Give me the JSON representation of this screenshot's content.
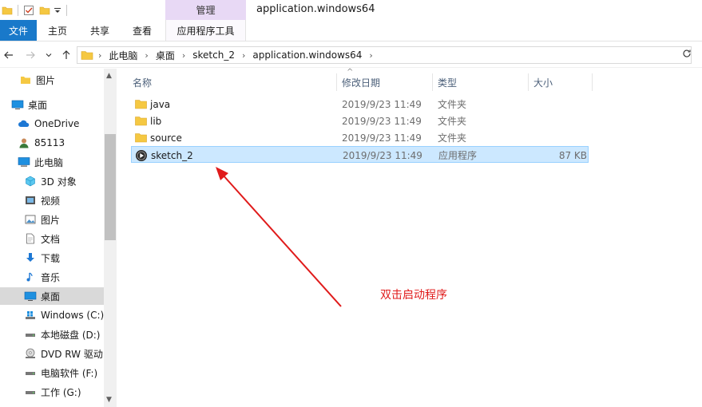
{
  "window": {
    "title": "application.windows64",
    "manage_tab": "管理"
  },
  "ribbon": {
    "tabs": [
      {
        "label": "文件"
      },
      {
        "label": "主页"
      },
      {
        "label": "共享"
      },
      {
        "label": "查看"
      },
      {
        "label": "应用程序工具"
      }
    ]
  },
  "address": {
    "breadcrumbs": [
      "此电脑",
      "桌面",
      "sketch_2",
      "application.windows64"
    ]
  },
  "nav": {
    "items": [
      {
        "label": "图片",
        "icon": "folder-icon"
      },
      {
        "label": "桌面",
        "icon": "desktop-icon"
      },
      {
        "label": "OneDrive",
        "icon": "cloud-icon"
      },
      {
        "label": "85113",
        "icon": "user-icon"
      },
      {
        "label": "此电脑",
        "icon": "computer-icon"
      },
      {
        "label": "3D 对象",
        "icon": "cube-icon"
      },
      {
        "label": "视频",
        "icon": "video-icon"
      },
      {
        "label": "图片",
        "icon": "pictures-icon"
      },
      {
        "label": "文档",
        "icon": "document-icon"
      },
      {
        "label": "下载",
        "icon": "download-icon"
      },
      {
        "label": "音乐",
        "icon": "music-icon"
      },
      {
        "label": "桌面",
        "icon": "desktop-icon"
      },
      {
        "label": "Windows (C:)",
        "icon": "windows-drive-icon"
      },
      {
        "label": "本地磁盘 (D:)",
        "icon": "drive-icon"
      },
      {
        "label": "DVD RW 驱动",
        "icon": "dvd-icon"
      },
      {
        "label": "电脑软件 (F:)",
        "icon": "drive-icon"
      },
      {
        "label": "工作 (G:)",
        "icon": "drive-icon"
      }
    ]
  },
  "columns": {
    "name": "名称",
    "date": "修改日期",
    "type": "类型",
    "size": "大小"
  },
  "files": [
    {
      "name": "java",
      "date": "2019/9/23 11:49",
      "type": "文件夹",
      "size": "",
      "icon": "folder-icon"
    },
    {
      "name": "lib",
      "date": "2019/9/23 11:49",
      "type": "文件夹",
      "size": "",
      "icon": "folder-icon"
    },
    {
      "name": "source",
      "date": "2019/9/23 11:49",
      "type": "文件夹",
      "size": "",
      "icon": "folder-icon"
    },
    {
      "name": "sketch_2",
      "date": "2019/9/23 11:49",
      "type": "应用程序",
      "size": "87 KB",
      "icon": "app-icon"
    }
  ],
  "annotation": {
    "text": "双击启动程序",
    "color": "#e01b1b"
  },
  "colors": {
    "accent": "#1979ca",
    "manage_tab": "#e8d9f5",
    "selection": "#cce8ff",
    "folder": "#f5c842"
  }
}
